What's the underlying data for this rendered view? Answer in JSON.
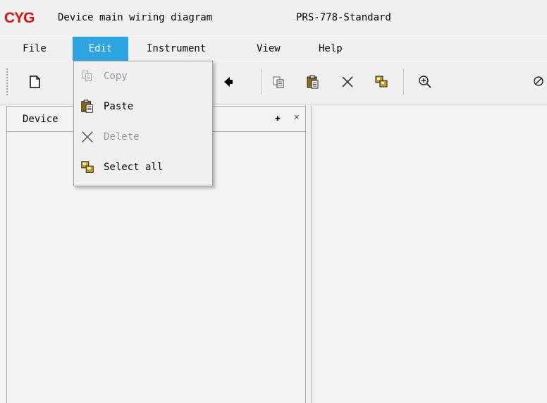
{
  "title": {
    "logo": "CYG",
    "text": "Device main wiring diagram",
    "model": "PRS-778-Standard"
  },
  "menu": {
    "file": "File",
    "edit": "Edit",
    "instrument": "Instrument",
    "view": "View",
    "help": "Help",
    "active": "Edit"
  },
  "toolbar": {
    "buttons": [
      "new-icon",
      "back-icon",
      "copy-icon",
      "paste-icon",
      "delete-icon",
      "select-all-icon",
      "zoom-in-icon",
      "zoom-out-icon"
    ]
  },
  "edit_menu": {
    "items": [
      {
        "label": "Copy",
        "icon": "copy-icon",
        "enabled": false
      },
      {
        "label": "Paste",
        "icon": "paste-icon",
        "enabled": true
      },
      {
        "label": "Delete",
        "icon": "delete-icon",
        "enabled": false
      },
      {
        "label": "Select all",
        "icon": "select-all-icon",
        "enabled": true
      }
    ]
  },
  "panel": {
    "title": "Device",
    "pin": "✚",
    "close": "×"
  },
  "colors": {
    "logo": "#e01010",
    "menu_highlight": "#2da5e3"
  }
}
